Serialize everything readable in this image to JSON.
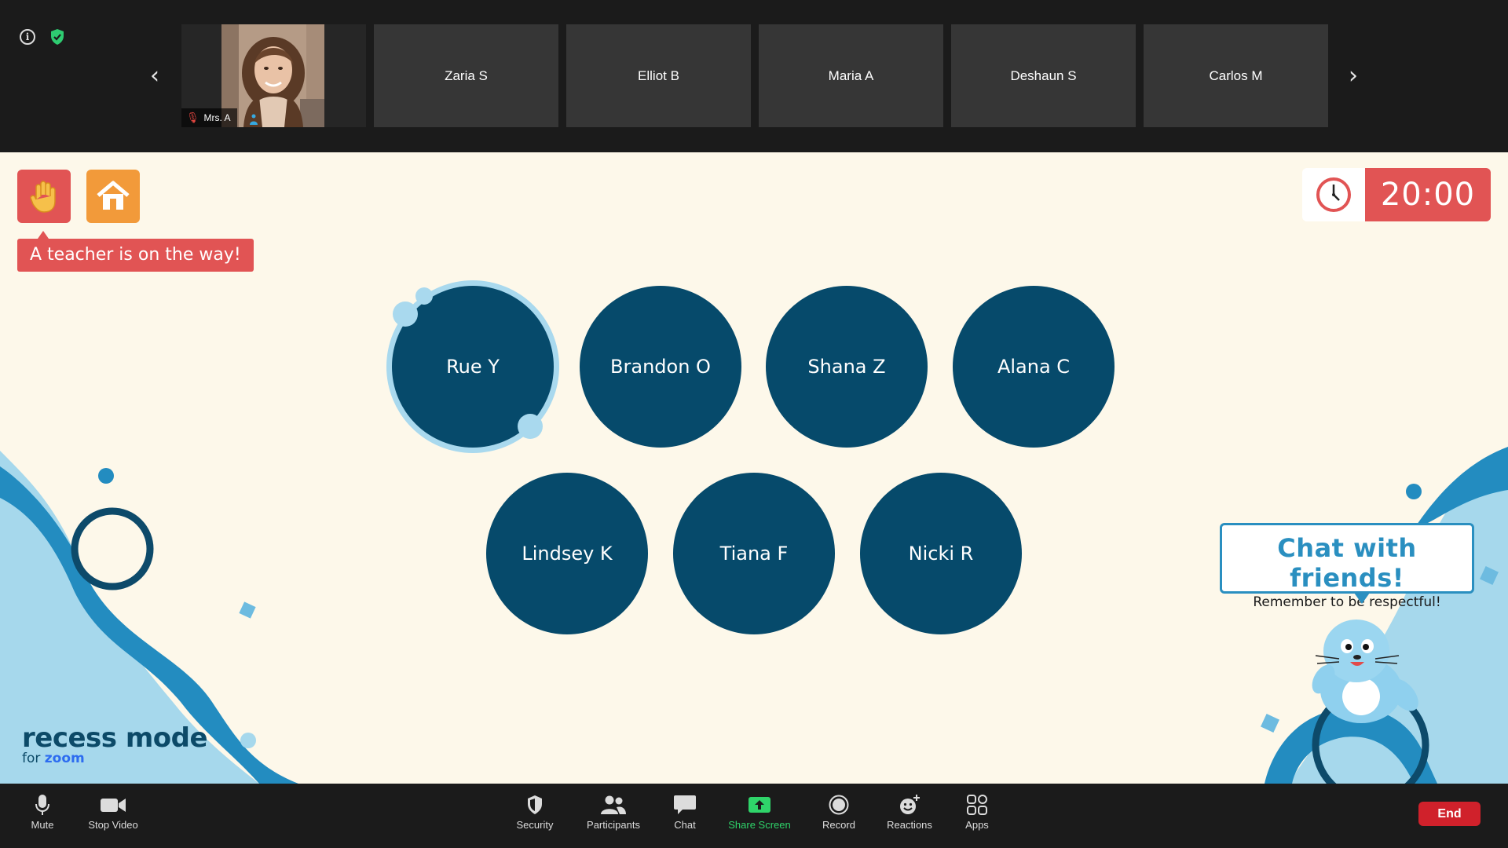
{
  "top_strip": {
    "self_tile": {
      "name": "Mrs. A",
      "mic_state": "muted",
      "spotlight": true
    },
    "participants": [
      {
        "name": "Zaria S"
      },
      {
        "name": "Elliot B"
      },
      {
        "name": "Maria A"
      },
      {
        "name": "Deshaun S"
      },
      {
        "name": "Carlos M"
      }
    ],
    "prev_icon": "chevron-left",
    "next_icon": "chevron-right",
    "info_icon": "i",
    "security_status": "encrypted"
  },
  "stage": {
    "raise_hand_icon": "hand",
    "home_icon": "house",
    "teacher_message": "A teacher is on the way!",
    "timer": {
      "value": "20:00",
      "icon": "clock"
    },
    "seats_row1": [
      {
        "name": "Rue Y",
        "active": true
      },
      {
        "name": "Brandon O",
        "active": false
      },
      {
        "name": "Shana Z",
        "active": false
      },
      {
        "name": "Alana C",
        "active": false
      }
    ],
    "seats_row2": [
      {
        "name": "Lindsey K",
        "active": false
      },
      {
        "name": "Tiana F",
        "active": false
      },
      {
        "name": "Nicki R",
        "active": false
      }
    ],
    "chat_prompt": {
      "title": "Chat with friends!",
      "subtitle": "Remember to be respectful!"
    },
    "brand": {
      "title": "recess mode",
      "subtitle_prefix": "for",
      "subtitle_brand": "zoom"
    }
  },
  "controls": {
    "mute": "Mute",
    "stop_video": "Stop Video",
    "security": "Security",
    "participants": "Participants",
    "chat": "Chat",
    "share_screen": "Share Screen",
    "record": "Record",
    "reactions": "Reactions",
    "apps": "Apps",
    "end": "End"
  },
  "colors": {
    "stage_bg": "#fdf8ea",
    "seat": "#064a6b",
    "accent_red": "#e15454",
    "accent_orange": "#f29a3a",
    "chat_blue": "#2a8fc0",
    "end_red": "#d0212b",
    "share_green": "#2fd46a"
  }
}
